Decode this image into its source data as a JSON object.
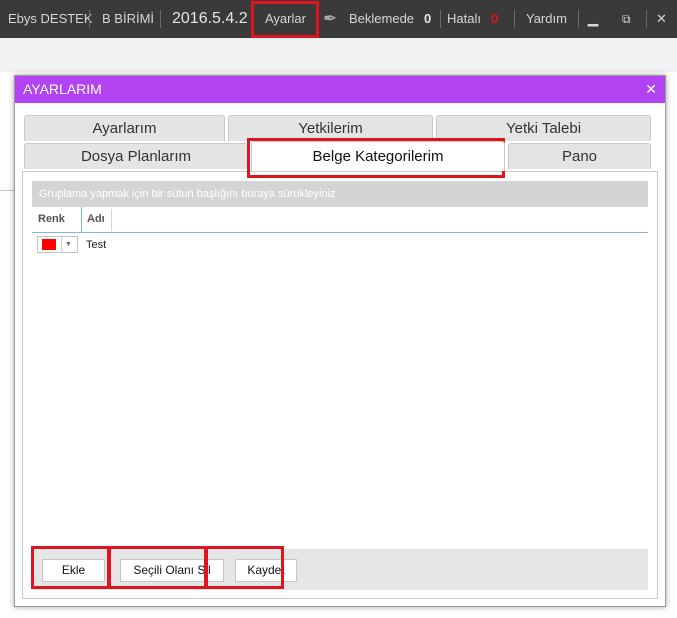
{
  "topbar": {
    "user": "Ebys DESTEK",
    "unit": "B BİRİMİ",
    "version": "2016.5.4.2",
    "settings": "Ayarlar",
    "pending_label": "Beklemede",
    "pending_count": "0",
    "error_label": "Hatalı",
    "error_count": "0",
    "help": "Yardım"
  },
  "dialog": {
    "title": "AYARLARIM",
    "close": "✕",
    "tabs_row1": [
      "Ayarlarım",
      "Yetkilerim",
      "Yetki Talebi"
    ],
    "tabs_row2": [
      "Dosya Planlarım",
      "Belge Kategorilerim",
      "Pano"
    ],
    "active_tab": "Belge Kategorilerim",
    "group_hint": "Gruplama yapmak için bir sütun başlığını buraya sürükleyiniz",
    "columns": [
      "Renk",
      "Adı"
    ],
    "rows": [
      {
        "color": "#ff0000",
        "name": "Test"
      }
    ],
    "buttons": {
      "add": "Ekle",
      "delete": "Seçili Olanı Sil",
      "save": "Kaydet"
    }
  },
  "colors": {
    "title_bar": "#b243f3",
    "app_bar": "#3a3a3a",
    "highlight": "#e0141e",
    "error_count": "#e0141e"
  }
}
